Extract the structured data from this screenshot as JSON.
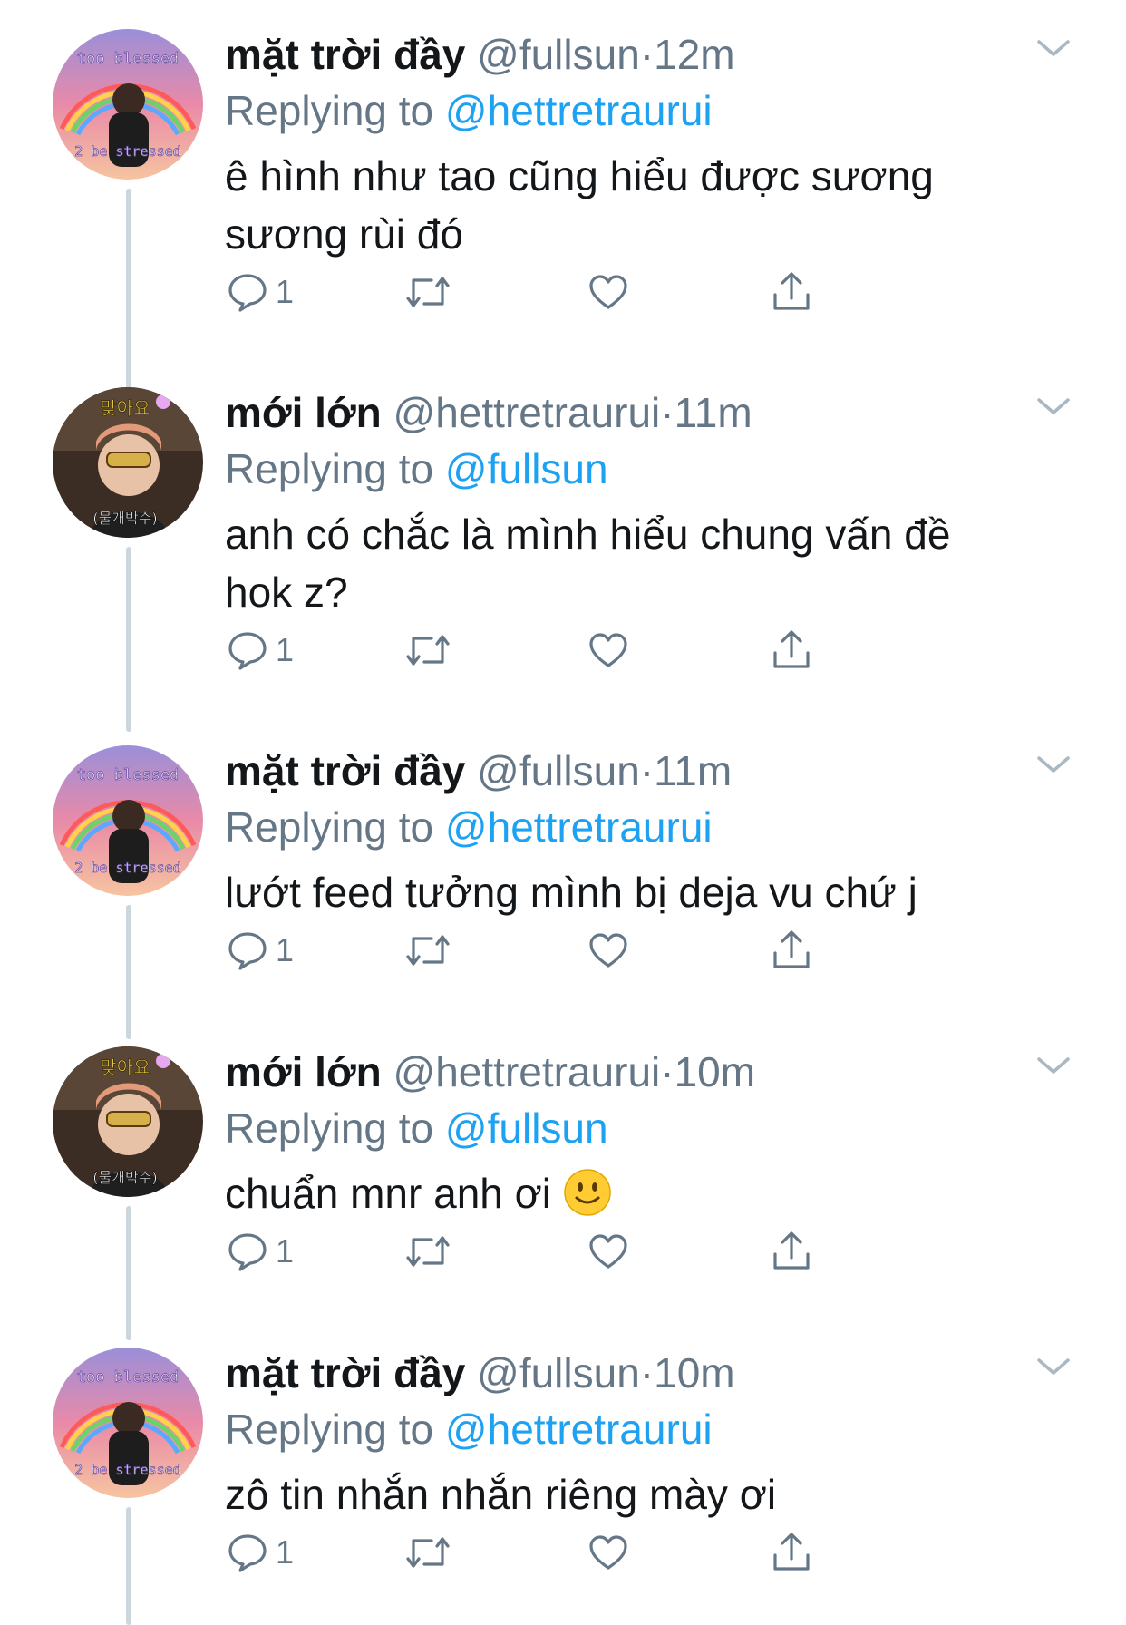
{
  "accent_color": "#1da1f2",
  "tweets": [
    {
      "avatar_type": "fullsun",
      "name": "mặt trời đầy",
      "handle": "@fullsun",
      "dot": "·",
      "time": "12m",
      "replying_prefix": "Replying to",
      "replying_to": "@hettretraurui",
      "text": "ê hình như tao cũng hiểu được sương sương rùi đó",
      "reply_count": "1"
    },
    {
      "avatar_type": "hettretraurui",
      "name": "mới lớn",
      "handle": "@hettretraurui",
      "dot": "·",
      "time": "11m",
      "replying_prefix": "Replying to",
      "replying_to": "@fullsun",
      "text": "anh có chắc là mình hiểu chung vấn đề hok z?",
      "reply_count": "1"
    },
    {
      "avatar_type": "fullsun",
      "name": "mặt trời đầy",
      "handle": "@fullsun",
      "dot": "·",
      "time": "11m",
      "replying_prefix": "Replying to",
      "replying_to": "@hettretraurui",
      "text": "lướt feed tưởng mình bị deja vu chứ j",
      "reply_count": "1"
    },
    {
      "avatar_type": "hettretraurui",
      "name": "mới lớn",
      "handle": "@hettretraurui",
      "dot": "·",
      "time": "10m",
      "replying_prefix": "Replying to",
      "replying_to": "@fullsun",
      "text": "chuẩn mnr anh ơi",
      "text_emoji": "slightly-smiling-face",
      "reply_count": "1"
    },
    {
      "avatar_type": "fullsun",
      "name": "mặt trời đầy",
      "handle": "@fullsun",
      "dot": "·",
      "time": "10m",
      "replying_prefix": "Replying to",
      "replying_to": "@hettretraurui",
      "text": "zô tin nhắn nhắn riêng mày ơi",
      "reply_count": "1"
    }
  ],
  "avatar_fullsun": {
    "top_text": "too blessed",
    "bottom_text": "2 be stressed"
  },
  "avatar_hettretraurui": {
    "top_text": "맞아요",
    "bottom_text": "(물개박수)"
  },
  "icons": [
    "reply-icon",
    "retweet-icon",
    "like-icon",
    "share-icon",
    "chevron-down-icon"
  ]
}
